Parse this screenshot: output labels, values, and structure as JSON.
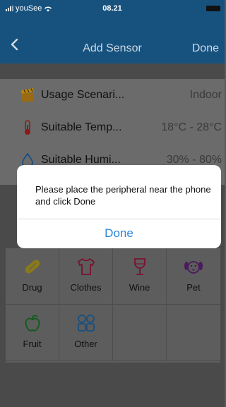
{
  "status_bar": {
    "carrier": "youSee",
    "time": "08.21"
  },
  "nav": {
    "title": "Add Sensor",
    "done": "Done"
  },
  "info_rows": [
    {
      "icon": "clapperboard-icon",
      "label": "Usage Scenari...",
      "value": "Indoor"
    },
    {
      "icon": "thermometer-icon",
      "label": "Suitable Temp...",
      "value": "18°C - 28°C"
    },
    {
      "icon": "water-drop-icon",
      "label": "Suitable Humi...",
      "value": "30% - 80%"
    }
  ],
  "categories": [
    {
      "icon": "pill-icon",
      "label": "Drug"
    },
    {
      "icon": "shirt-icon",
      "label": "Clothes"
    },
    {
      "icon": "wine-glass-icon",
      "label": "Wine"
    },
    {
      "icon": "dog-face-icon",
      "label": "Pet"
    },
    {
      "icon": "apple-icon",
      "label": "Fruit"
    },
    {
      "icon": "grid-icon",
      "label": "Other"
    }
  ],
  "dialog": {
    "message": "Please place the peripheral near the phone and click Done",
    "button": "Done"
  },
  "colors": {
    "nav_bg": "#17527f",
    "accent": "#2b86d8"
  }
}
